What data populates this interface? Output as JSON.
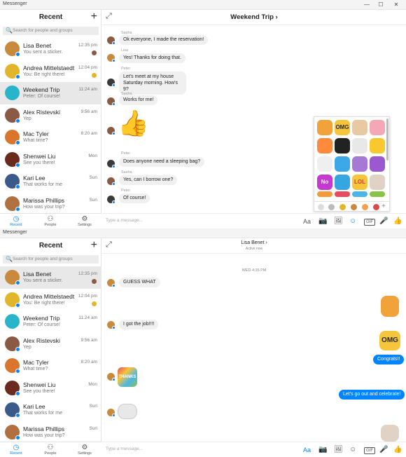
{
  "app": {
    "window_title": "Messenger",
    "controls": {
      "minimize": "—",
      "maximize": "☐",
      "close": "✕"
    }
  },
  "sidebar": {
    "title": "Recent",
    "compose_icon": "+",
    "search_icon": "🔍",
    "search_placeholder": "Search for people and groups",
    "conversations": [
      {
        "name": "Lisa Benet",
        "preview": "You sent a sticker.",
        "time": "12:35 pm",
        "color": "#c98a3e"
      },
      {
        "name": "Andrea Mittelstaedt",
        "preview": "You: Be right there!",
        "time": "12:04 pm",
        "color": "#e2b62a"
      },
      {
        "name": "Weekend Trip",
        "preview": "Peter: Of course!",
        "time": "11:24 am",
        "color": "#29b5c9"
      },
      {
        "name": "Alex Ristevski",
        "preview": "Yep",
        "time": "9:56 am",
        "color": "#8a5a44"
      },
      {
        "name": "Mac Tyler",
        "preview": "What time?",
        "time": "8:20 am",
        "color": "#d9752d"
      },
      {
        "name": "Shenwei Liu",
        "preview": "See you there!",
        "time": "Mon",
        "color": "#6a2a1d"
      },
      {
        "name": "Kari Lee",
        "preview": "That works for me",
        "time": "Sun",
        "color": "#3a5a8a"
      },
      {
        "name": "Marissa Phillips",
        "preview": "How was your trip?",
        "time": "Sun",
        "color": "#b07040"
      }
    ],
    "nav": [
      {
        "icon": "◷",
        "label": "Recent"
      },
      {
        "icon": "⚇",
        "label": "People"
      },
      {
        "icon": "⚙",
        "label": "Settings"
      }
    ]
  },
  "chat_top": {
    "title": "Weekend Trip ›",
    "expand_icon": "⤢",
    "messages": [
      {
        "sender": "Sasha",
        "text": "Ok everyone, I made the reservation!"
      },
      {
        "sender": "Lisa",
        "text": "Yes! Thanks for doing that."
      },
      {
        "sender": "Peter",
        "text": "Let's meet at my house Saturday morning. How's 9?"
      },
      {
        "sender": "Sasha",
        "text": "Works for me!"
      },
      {
        "sender": "Peter",
        "text": "Does anyone need a sleeping bag?"
      },
      {
        "sender": "Sasha",
        "text": "Yes, can I borrow one?"
      },
      {
        "sender": "Peter",
        "text": "Of course!"
      }
    ],
    "like_icon": "👍"
  },
  "chat_bottom": {
    "title": "Lisa Benet ›",
    "subtitle": "Active now",
    "date": "WED 4:35 PM",
    "messages": [
      {
        "text": "GUESS WHAT"
      },
      {
        "text": "I got the job!!!!"
      },
      {
        "text": "Congrats!!"
      },
      {
        "text": "Let's go out and celebrate!"
      }
    ],
    "stickers": {
      "omg": "OMG",
      "thanks": "THANKS"
    }
  },
  "composer": {
    "placeholder": "Type a message...",
    "tools": [
      "Aa",
      "📷",
      "🖼",
      "☺",
      "GIF",
      "🎤",
      "👍"
    ]
  },
  "sticker_panel": {
    "omg": "OMG",
    "no": "No",
    "lol": "LOL",
    "add": "+"
  },
  "colors": {
    "accent": "#0084ff",
    "bubble_in": "#f1f0f0",
    "active_row": "#e8e8e8"
  }
}
